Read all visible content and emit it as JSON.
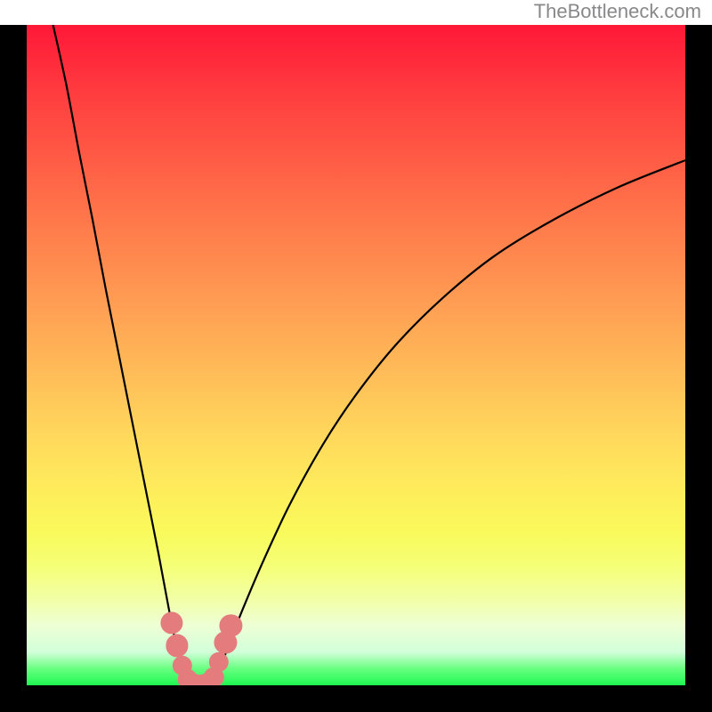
{
  "attribution": "TheBottleneck.com",
  "chart_data": {
    "type": "line",
    "title": "",
    "xlabel": "",
    "ylabel": "",
    "xlim": [
      0,
      100
    ],
    "ylim": [
      0,
      100
    ],
    "legend_position": "none",
    "background_gradient_stops": [
      {
        "pct": 0,
        "color": "#ff1838"
      },
      {
        "pct": 50,
        "color": "#ffb757"
      },
      {
        "pct": 78,
        "color": "#f9fa5b"
      },
      {
        "pct": 97,
        "color": "#67ff80"
      },
      {
        "pct": 100,
        "color": "#1ef851"
      }
    ],
    "series": [
      {
        "name": "left-arm",
        "x": [
          4.0,
          6.0,
          8.0,
          10.0,
          12.0,
          14.0,
          16.0,
          18.0,
          20.0,
          21.5,
          22.5,
          23.3,
          24.0,
          25.0
        ],
        "y": [
          100.0,
          91.0,
          80.5,
          70.5,
          60.0,
          50.0,
          40.0,
          30.0,
          20.0,
          12.0,
          7.0,
          3.5,
          1.5,
          0.5
        ]
      },
      {
        "name": "right-arm",
        "x": [
          28.0,
          29.5,
          31.0,
          33.0,
          36.0,
          40.0,
          45.0,
          50.0,
          56.0,
          63.0,
          71.0,
          80.0,
          90.0,
          100.0
        ],
        "y": [
          0.5,
          3.0,
          7.0,
          12.0,
          19.0,
          27.5,
          36.5,
          44.0,
          51.5,
          58.5,
          65.0,
          70.5,
          75.5,
          79.5
        ]
      },
      {
        "name": "valley-bottom",
        "x": [
          25.0,
          25.8,
          26.6,
          27.2,
          28.0
        ],
        "y": [
          0.5,
          0.1,
          0.05,
          0.1,
          0.5
        ]
      }
    ],
    "markers": [
      {
        "x": 22.0,
        "y": 9.5,
        "r": 1.8
      },
      {
        "x": 22.8,
        "y": 6.0,
        "r": 1.8
      },
      {
        "x": 23.6,
        "y": 3.0,
        "r": 1.6
      },
      {
        "x": 24.4,
        "y": 0.9,
        "r": 1.6
      },
      {
        "x": 25.4,
        "y": 0.3,
        "r": 1.6
      },
      {
        "x": 26.6,
        "y": 0.2,
        "r": 1.6
      },
      {
        "x": 27.6,
        "y": 0.4,
        "r": 1.6
      },
      {
        "x": 28.4,
        "y": 1.2,
        "r": 1.6
      },
      {
        "x": 29.2,
        "y": 3.5,
        "r": 1.6
      },
      {
        "x": 30.2,
        "y": 6.5,
        "r": 1.8
      },
      {
        "x": 31.0,
        "y": 9.0,
        "r": 1.8
      }
    ]
  }
}
